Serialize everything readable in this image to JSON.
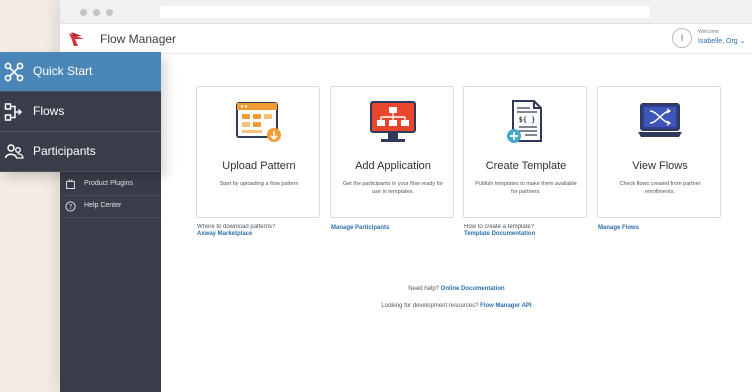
{
  "app": {
    "title": "Flow Manager",
    "welcome_label": "Welcome",
    "user_name": "Isabelle, Org",
    "avatar_initial": "I",
    "dropdown_glyph": "⌄"
  },
  "nav": [
    {
      "label": "Quick Start",
      "icon": "nodes-icon",
      "active": true
    },
    {
      "label": "Flows",
      "icon": "flow-icon",
      "active": false
    },
    {
      "label": "Participants",
      "icon": "participants-icon",
      "active": false
    }
  ],
  "sidebar_sub": [
    {
      "label": "Product Plugins",
      "icon": "plugin-icon"
    },
    {
      "label": "Help Center",
      "icon": "help-icon"
    }
  ],
  "cards": [
    {
      "title": "Upload Pattern",
      "desc": "Start by uploading a flow pattern",
      "question": "Where to download patterns?",
      "link": "Axway Marketplace",
      "illustration": "upload-pattern-illustration"
    },
    {
      "title": "Add Application",
      "desc": "Get the participants in your flow ready for use in templates.",
      "question": "",
      "link": "Manage Participants",
      "illustration": "add-application-illustration"
    },
    {
      "title": "Create Template",
      "desc": "Publish templates to make them available for partners.",
      "question": "How to create a template?",
      "link": "Template Documentation",
      "illustration": "create-template-illustration"
    },
    {
      "title": "View Flows",
      "desc": "Check flows created from partner enrollments.",
      "question": "",
      "link": "Manage Flows",
      "illustration": "view-flows-illustration"
    }
  ],
  "footer": {
    "help_text": "Need help?",
    "help_link": "Online Documentation",
    "dev_text": "Looking for development resources?",
    "dev_link": "Flow Manager API"
  },
  "colors": {
    "accent": "#4a87b8",
    "link": "#2f6fad",
    "sidebar": "#383d49",
    "logo_red": "#d9303a",
    "illus_orange": "#f39c33",
    "illus_navy": "#2e3a57"
  }
}
